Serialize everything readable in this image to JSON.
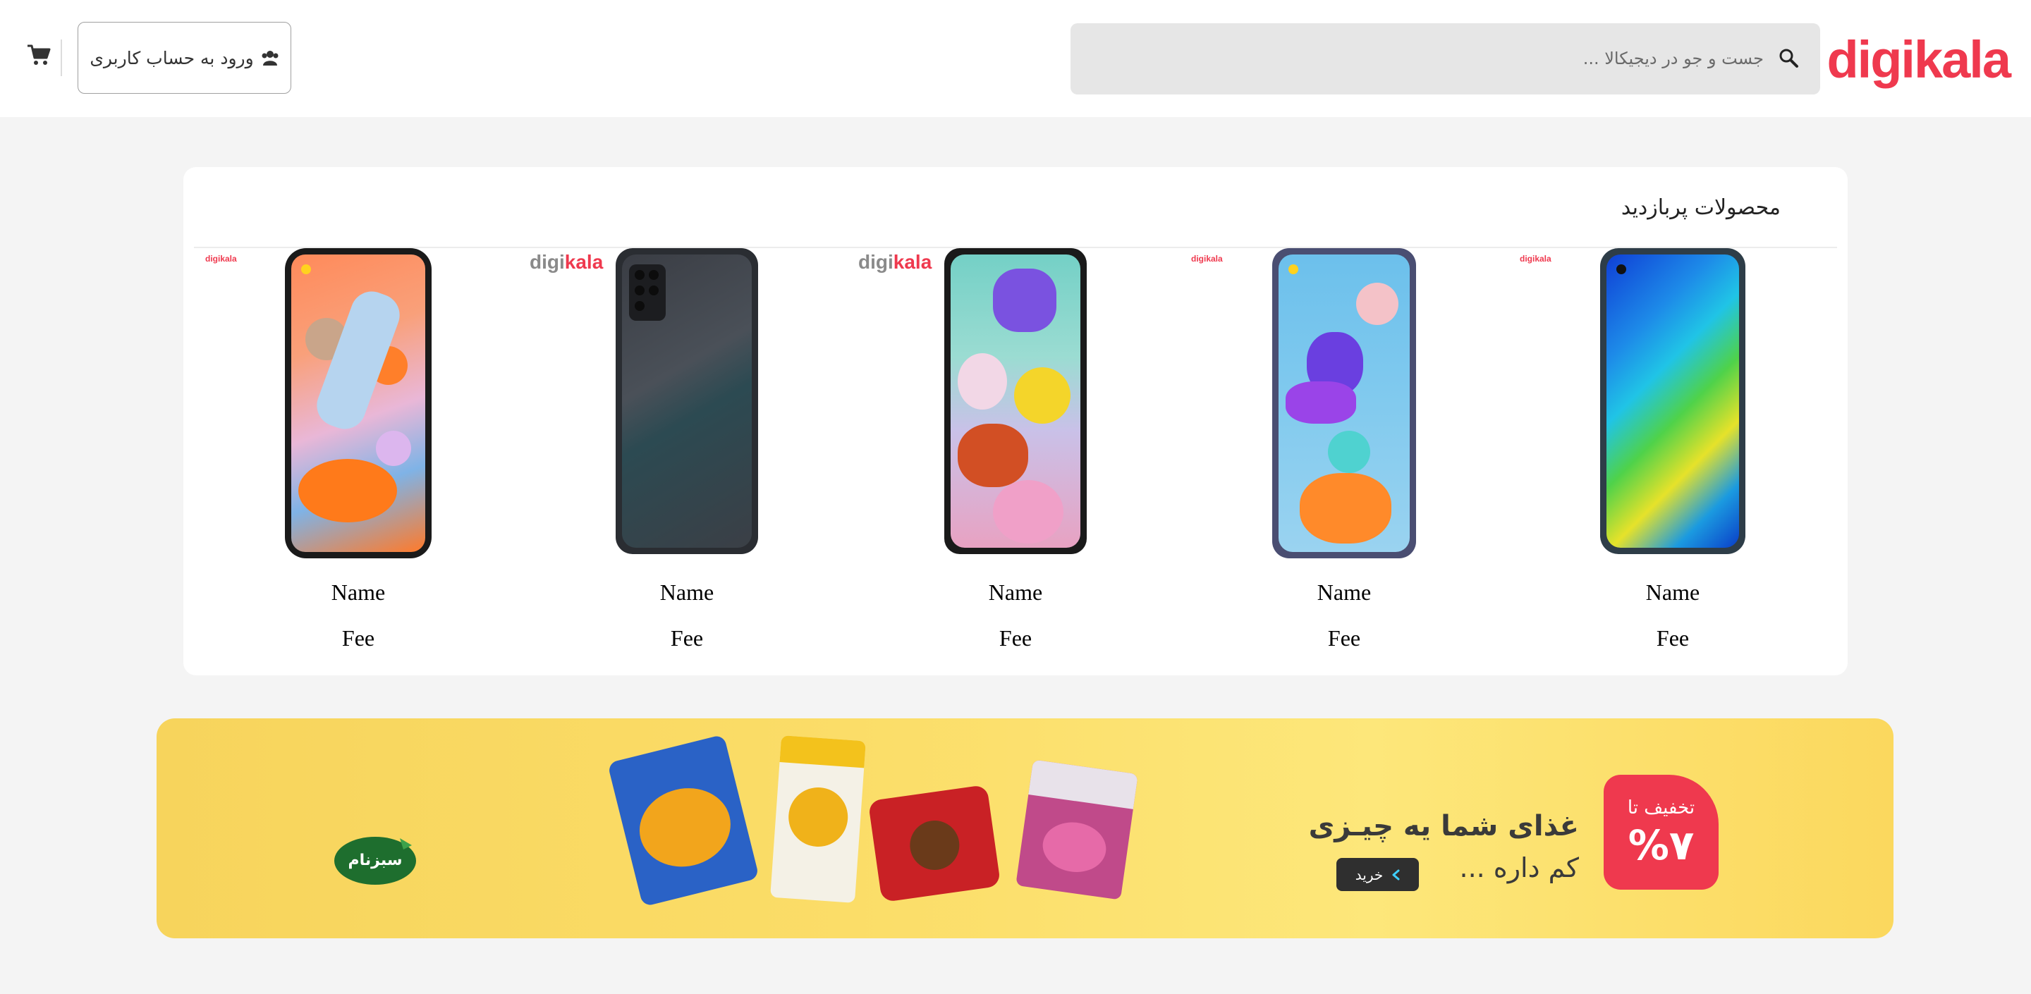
{
  "header": {
    "logo_text": "digikala",
    "search_placeholder": "جست و جو در دیجیکالا ...",
    "login_label": "ورود به حساب کاربری",
    "icons": [
      "search-icon",
      "users-icon",
      "cart-icon"
    ]
  },
  "products": {
    "title": "محصولات پربازدید",
    "items": [
      {
        "name": "Name",
        "fee": "Fee",
        "logo": "digikala"
      },
      {
        "name": "Name",
        "fee": "Fee",
        "logo": "digikala"
      },
      {
        "name": "Name",
        "fee": "Fee",
        "logo": "digikala"
      },
      {
        "name": "Name",
        "fee": "Fee",
        "logo": "digikala"
      },
      {
        "name": "Name",
        "fee": "Fee",
        "logo": "digikala"
      }
    ]
  },
  "banner": {
    "badge_top": "تخفیف تا",
    "badge_percent": "%۷",
    "title": "غذای شما یه چیـزی",
    "subtitle": "کم داره ...",
    "buy_label": "خرید",
    "brand": "سبزنام"
  },
  "colors": {
    "brand_red": "#ef394e",
    "banner_yellow": "#fbdd68",
    "page_bg": "#f4f4f4"
  }
}
